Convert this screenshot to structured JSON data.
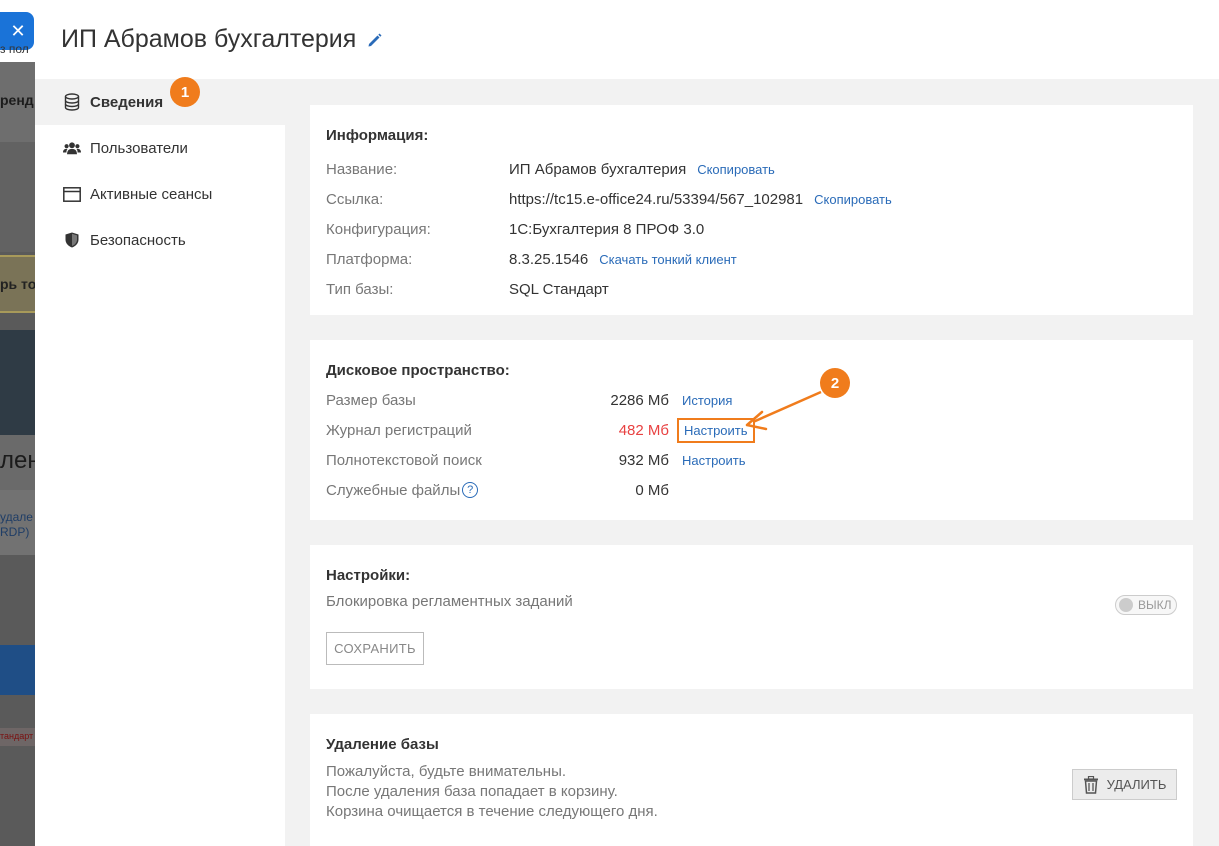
{
  "background": {
    "close_glyph": "✕",
    "fragments": [
      "з пол",
      "ренд",
      "рь то",
      "лен",
      "удале",
      "RDP)",
      "тандарт"
    ]
  },
  "drawer": {
    "title": "ИП Абрамов бухгалтерия",
    "edit_icon": "pencil-icon"
  },
  "sidebar": {
    "items": [
      {
        "label": "Сведения",
        "icon": "database-icon",
        "active": true
      },
      {
        "label": "Пользователи",
        "icon": "users-icon",
        "active": false
      },
      {
        "label": "Активные сеансы",
        "icon": "window-icon",
        "active": false
      },
      {
        "label": "Безопасность",
        "icon": "shield-icon",
        "active": false
      }
    ]
  },
  "annotations": {
    "badge1": "1",
    "badge2": "2",
    "color": "#f07c1c"
  },
  "info": {
    "title": "Информация:",
    "rows": [
      {
        "label": "Название:",
        "value": "ИП Абрамов бухгалтерия",
        "link": "Скопировать"
      },
      {
        "label": "Ссылка:",
        "value": "https://tc15.e-office24.ru/53394/567_102981",
        "link": "Скопировать"
      },
      {
        "label": "Конфигурация:",
        "value": "1С:Бухгалтерия 8 ПРОФ 3.0",
        "link": ""
      },
      {
        "label": "Платформа:",
        "value": "8.3.25.1546",
        "link": "Скачать тонкий клиент"
      },
      {
        "label": "Тип базы:",
        "value": "SQL Стандарт",
        "link": ""
      }
    ]
  },
  "disk": {
    "title": "Дисковое пространство:",
    "rows": [
      {
        "label": "Размер базы",
        "value": "2286 Мб",
        "link": "История"
      },
      {
        "label": "Журнал регистраций",
        "value": "482 Мб",
        "link": "Настроить"
      },
      {
        "label": "Полнотекстовой поиск",
        "value": "932 Мб",
        "link": "Настроить"
      },
      {
        "label": "Служебные файлы",
        "value": "0 Мб",
        "link": "",
        "help": "?"
      }
    ],
    "warn_color": "#e84141"
  },
  "settings": {
    "title": "Настройки:",
    "option_label": "Блокировка регламентных заданий",
    "toggle_text": "ВЫКЛ",
    "save_label": "СОХРАНИТЬ"
  },
  "delete": {
    "title": "Удаление базы",
    "lines": [
      "Пожалуйста, будьте внимательны.",
      "После удаления база попадает в корзину.",
      "Корзина очищается в течение следующего дня."
    ],
    "button_label": "УДАЛИТЬ"
  }
}
